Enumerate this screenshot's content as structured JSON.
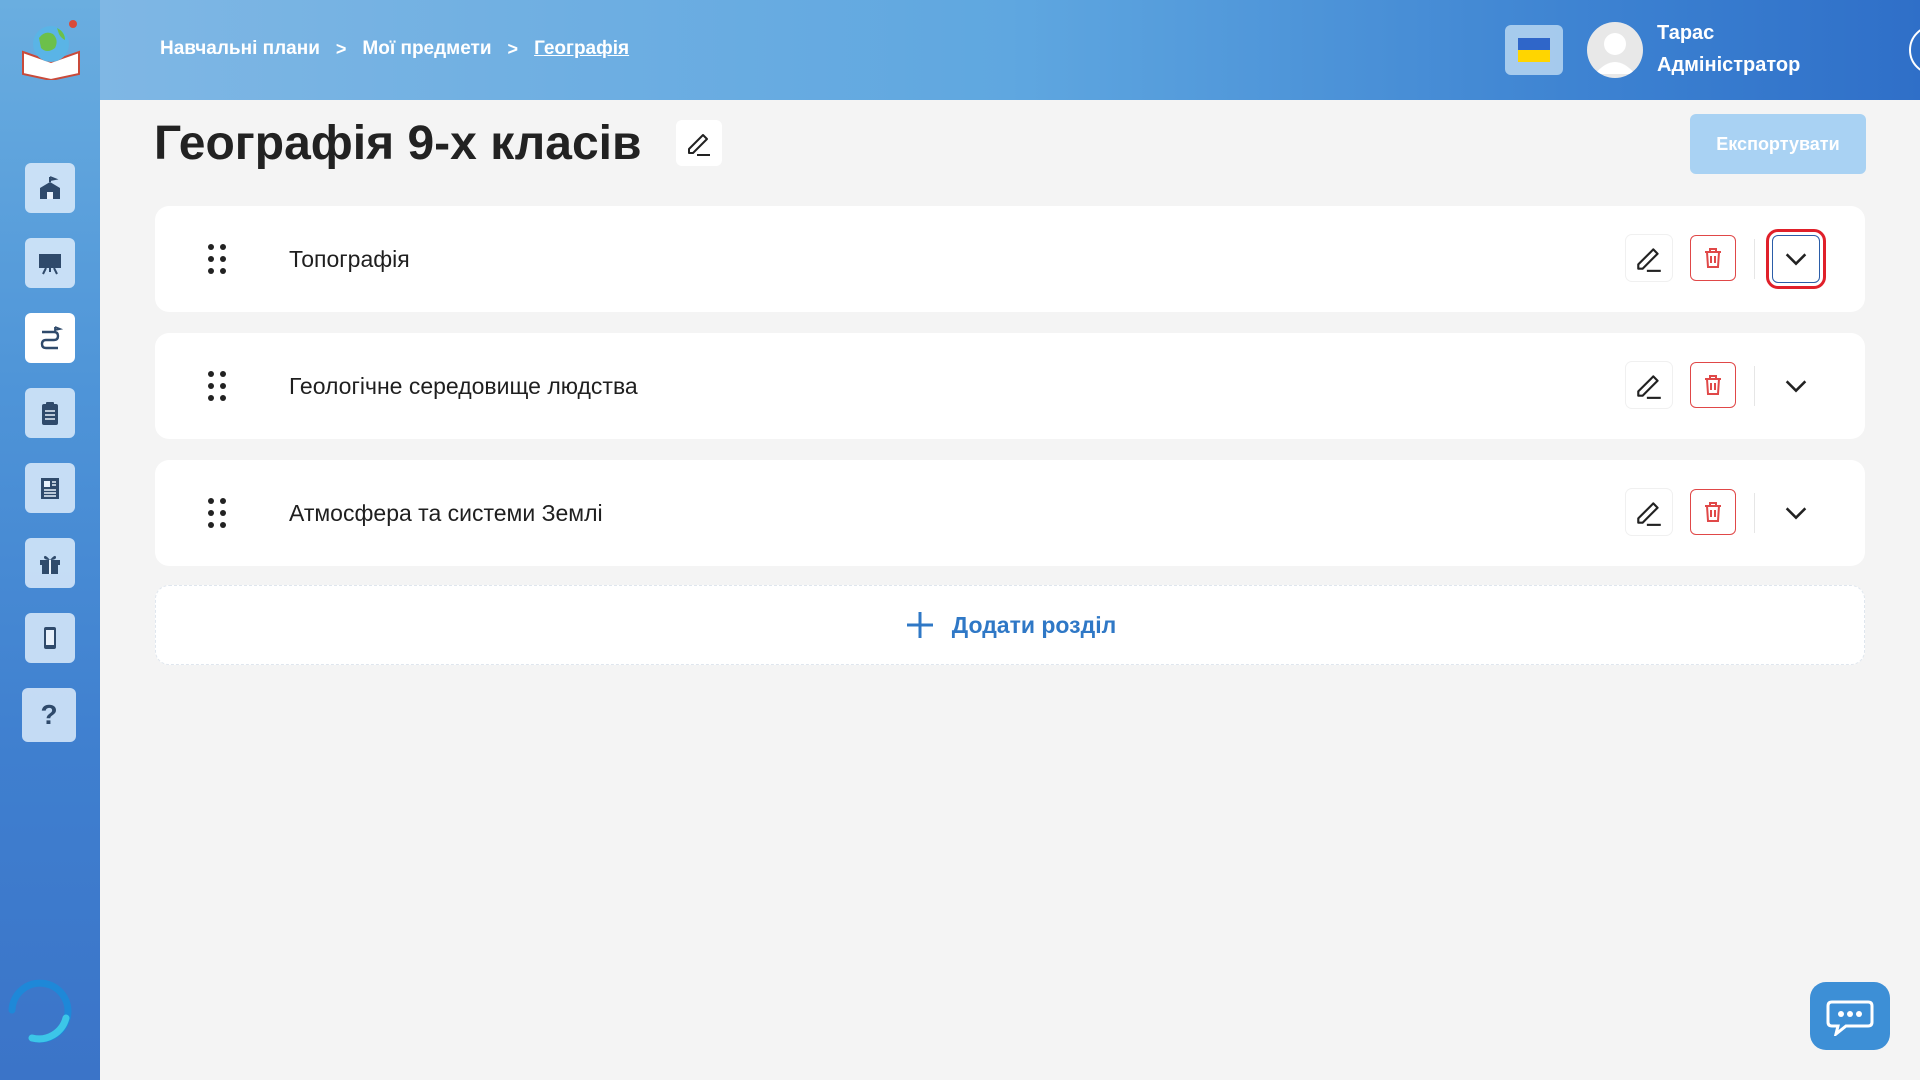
{
  "breadcrumb": {
    "items": [
      "Навчальні плани",
      "Мої предмети",
      "Географія"
    ],
    "separator": ">"
  },
  "user": {
    "name": "Тарас",
    "role": "Адміністратор"
  },
  "page": {
    "title": "Географія 9-х класів",
    "export_label": "Експортувати"
  },
  "sections": [
    {
      "title": "Топографія"
    },
    {
      "title": "Геологічне середовище людства"
    },
    {
      "title": "Атмосфера та системи Землі"
    }
  ],
  "add_section_label": "Додати розділ",
  "sidebar": {
    "items": [
      "school-icon",
      "presentation-icon",
      "route-icon",
      "clipboard-icon",
      "document-icon",
      "gift-icon",
      "mobile-icon"
    ],
    "help_label": "?"
  },
  "colors": {
    "accent": "#2f78c6",
    "danger": "#e04848",
    "highlight": "#e0202a",
    "export_disabled": "#a9d2f3"
  }
}
